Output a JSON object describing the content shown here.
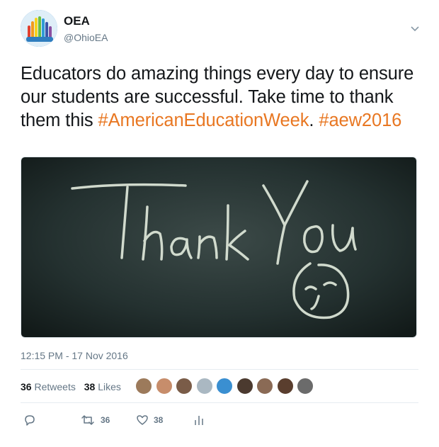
{
  "account": {
    "name": "OEA",
    "handle": "@OhioEA",
    "avatar_icon": "raised-hands-logo-icon"
  },
  "tweet": {
    "text_parts": [
      {
        "text": "Educators do amazing things every day to ensure our students are successful. Take time to thank them this ",
        "kind": "plain"
      },
      {
        "text": "#AmericanEducationWeek",
        "kind": "hashtag"
      },
      {
        "text": ". ",
        "kind": "plain"
      },
      {
        "text": "#aew2016",
        "kind": "hashtag"
      }
    ],
    "hashtag_color": "#e87722",
    "media": {
      "icon": "thank-you-chalkboard-image",
      "chalk_text": "Thank You"
    },
    "timestamp": "12:15 PM - 17 Nov 2016"
  },
  "stats": {
    "retweets_count": "36",
    "retweets_label": "Retweets",
    "likes_count": "38",
    "likes_label": "Likes",
    "liker_avatar_colors": [
      "#9c7a5b",
      "#c78d6b",
      "#7a5c48",
      "#aab8c2",
      "#3a8fd1",
      "#4b3a2f",
      "#8a6a55",
      "#5a3e2e",
      "#6b6b6b"
    ]
  },
  "actions": {
    "reply_icon": "reply-icon",
    "retweet_icon": "retweet-icon",
    "retweet_count": "36",
    "like_icon": "heart-icon",
    "like_count": "38",
    "analytics_icon": "analytics-icon"
  }
}
